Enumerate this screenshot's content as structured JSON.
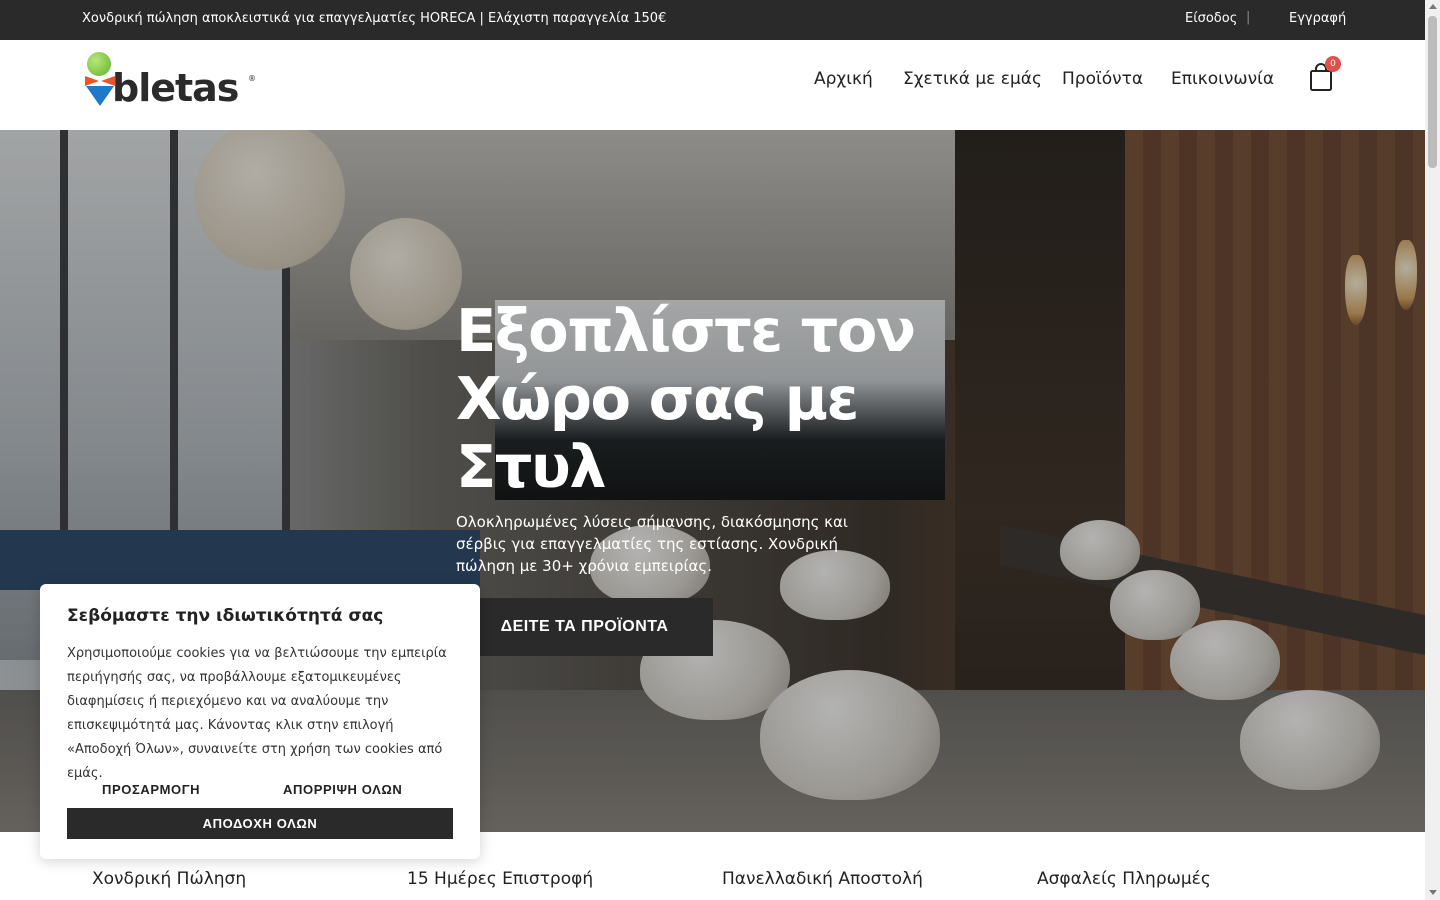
{
  "topbar": {
    "message": "Χονδρική πώληση αποκλειστικά για επαγγελματίες HORECA | Ελάχιστη παραγγελία 150€",
    "login": "Είσοδος",
    "separator": "|",
    "register": "Εγγραφή"
  },
  "header": {
    "logo_text": "bletas",
    "logo_mark": "®",
    "nav": [
      "Αρχική",
      "Σχετικά με εμάς",
      "Προϊόντα",
      "Επικοινωνία"
    ],
    "cart_icon": "shopping-bag-icon",
    "cart_count": "0"
  },
  "hero": {
    "title": "Εξοπλίστε τον Χώρο σας με Στυλ",
    "subtitle": "Ολοκληρωμένες λύσεις σήμανσης, διακόσμησης και σέρβις για επαγγελματίες της εστίασης. Χονδρική πώληση με 30+ χρόνια εμπειρίας.",
    "cta": "ΔΕΙΤΕ ΤΑ ΠΡΟΪΟΝΤΑ"
  },
  "features": [
    "Χονδρική Πώληση",
    "15 Ημέρες Επιστροφή",
    "Πανελλαδική Αποστολή",
    "Ασφαλείς Πληρωμές"
  ],
  "cookie": {
    "title": "Σεβόμαστε την ιδιωτικότητά σας",
    "body": "Χρησιμοποιούμε cookies για να βελτιώσουμε την εμπειρία περιήγησής σας, να προβάλλουμε εξατομικευμένες διαφημίσεις ή περιεχόμενο και να αναλύουμε την επισκεψιμότητά μας. Κάνοντας κλικ στην επιλογή «Αποδοχή Όλων», συναινείτε στη χρήση των cookies από εμάς.",
    "customize": "ΠΡΟΣΑΡΜΟΓΗ",
    "reject": "ΑΠΟΡΡΙΨΗ ΟΛΩΝ",
    "accept": "ΑΠΟΔΟΧΗ ΟΛΩΝ"
  },
  "colors": {
    "topbar_bg": "#2a2a2a",
    "button_dark": "#2a2a2a",
    "badge": "#e0514a",
    "logo_green": "#5fb22a",
    "logo_orange": "#e8542c",
    "logo_blue": "#1e7ac8"
  }
}
